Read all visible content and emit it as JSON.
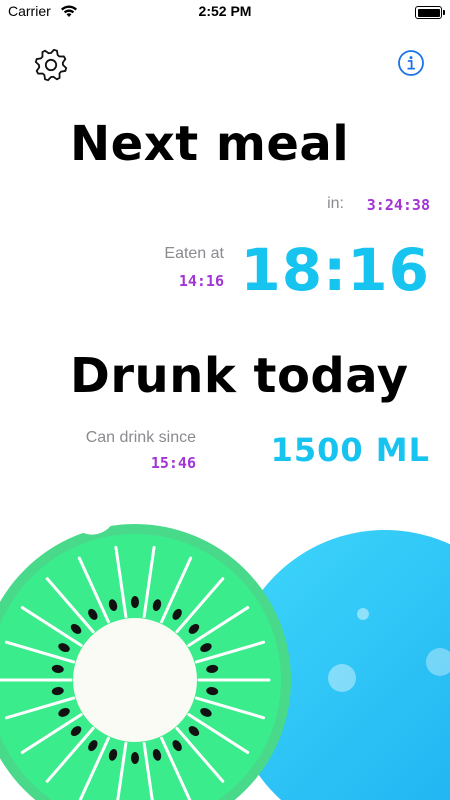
{
  "status_bar": {
    "carrier": "Carrier",
    "time": "2:52 PM",
    "battery_level": 1.0
  },
  "toolbar": {
    "settings_icon": "gear-icon",
    "info_icon": "info-circle-icon",
    "info_color": "#1a73e8"
  },
  "next_meal": {
    "title": "Next meal",
    "in_label": "in:",
    "countdown": "3:24:38",
    "eaten_label": "Eaten at",
    "eaten_time": "14:16",
    "next_time": "18:16"
  },
  "drunk_today": {
    "title": "Drunk today",
    "since_label": "Can drink since",
    "since_time": "15:46",
    "amount": "1500 ML"
  },
  "colors": {
    "accent_purple": "#a235d6",
    "accent_blue": "#17c3ef",
    "kiwi_green": "#3bec8c",
    "water_blue": "#27c4f5"
  }
}
